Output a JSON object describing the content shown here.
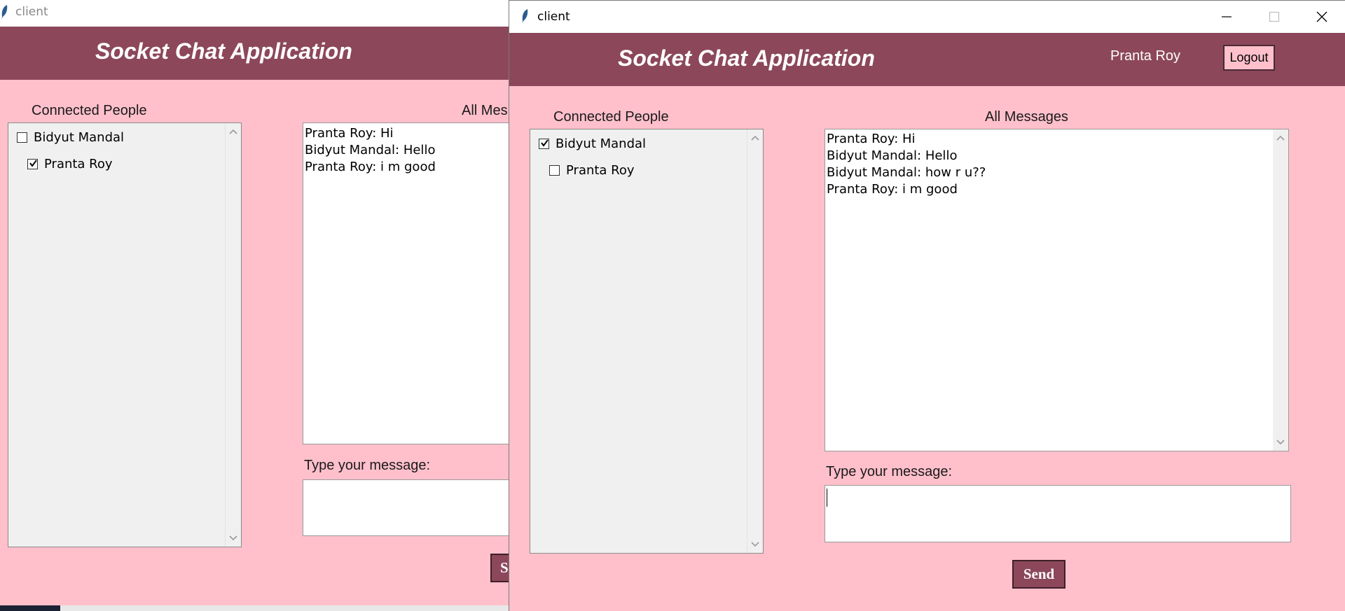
{
  "back_window": {
    "title": "client",
    "app_title": "Socket Chat Application",
    "connected_people_label": "Connected People",
    "people": [
      {
        "name": "Bidyut Mandal",
        "checked": false
      },
      {
        "name": "Pranta Roy",
        "checked": true
      }
    ],
    "all_messages_label": "All Mes",
    "messages": [
      "Pranta Roy: Hi",
      "Bidyut Mandal: Hello",
      "Pranta Roy: i m good"
    ],
    "type_message_label": "Type your message:",
    "send_label": "S"
  },
  "front_window": {
    "title": "client",
    "app_title": "Socket Chat Application",
    "user_name": "Pranta Roy",
    "logout_label": "Logout",
    "connected_people_label": "Connected People",
    "people": [
      {
        "name": "Bidyut Mandal",
        "checked": true
      },
      {
        "name": "Pranta Roy",
        "checked": false
      }
    ],
    "all_messages_label": "All Messages",
    "messages": [
      "Pranta Roy: Hi",
      "Bidyut Mandal: Hello",
      "Bidyut Mandal: how r u??",
      "Pranta Roy: i m good"
    ],
    "type_message_label": "Type your message:",
    "message_input_value": "",
    "send_label": "Send"
  },
  "colors": {
    "header": "#8c475b",
    "background": "#ffc0cb",
    "send_button": "#8c475b",
    "logout_button": "#ffc0cb"
  },
  "icons": [
    "feather-icon",
    "minimize-icon",
    "maximize-icon",
    "close-icon",
    "chevron-up-icon",
    "chevron-down-icon",
    "checkmark-icon"
  ]
}
